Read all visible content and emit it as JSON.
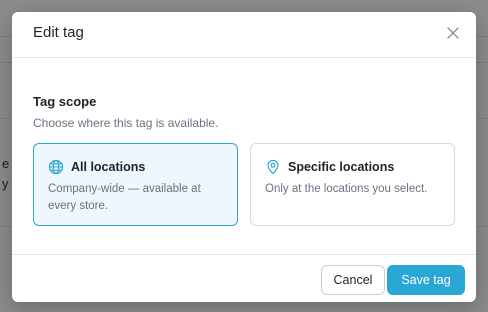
{
  "background": {
    "partial_text_1": "e A",
    "partial_text_2": "y a"
  },
  "modal": {
    "title": "Edit tag",
    "close_icon": "close-icon",
    "section_title": "Tag scope",
    "section_description": "Choose where this tag is available.",
    "options": [
      {
        "title": "All locations",
        "description": "Company-wide — available at every store.",
        "icon": "globe-icon",
        "selected": true
      },
      {
        "title": "Specific locations",
        "description": "Only at the locations you select.",
        "icon": "location-pin-icon",
        "selected": false
      }
    ],
    "cancel_label": "Cancel",
    "save_label": "Save tag"
  },
  "colors": {
    "accent": "#2ba7d6",
    "selected_bg": "#edf7fd",
    "overlay": "rgba(0,0,0,0.45)"
  }
}
